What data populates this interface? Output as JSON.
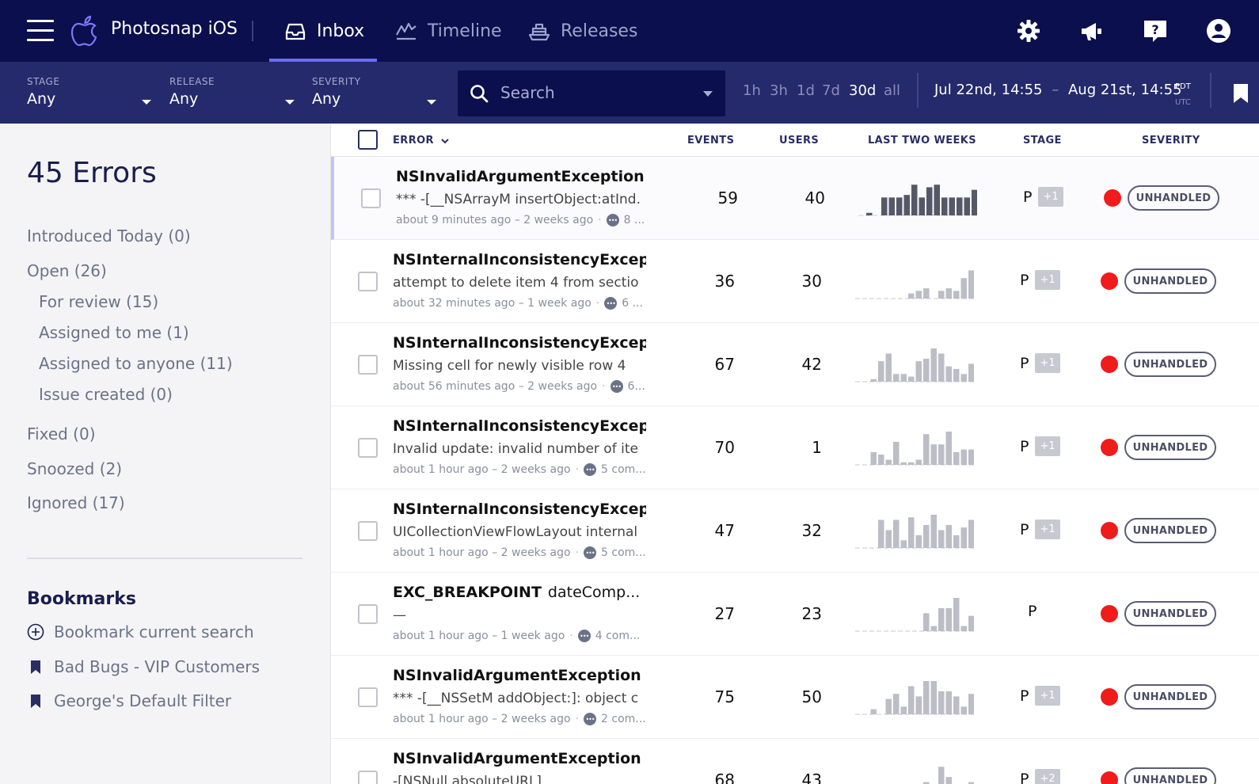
{
  "nav": {
    "app_name": "Photosnap iOS",
    "tabs": [
      {
        "label": "Inbox",
        "icon": "inbox-icon",
        "active": true
      },
      {
        "label": "Timeline",
        "icon": "timeline-icon",
        "active": false
      },
      {
        "label": "Releases",
        "icon": "releases-icon",
        "active": false
      }
    ],
    "right_icons": [
      "settings-icon",
      "announcements-icon",
      "help-icon",
      "account-icon"
    ]
  },
  "filters": {
    "stage": {
      "label": "STAGE",
      "value": "Any"
    },
    "release": {
      "label": "RELEASE",
      "value": "Any"
    },
    "severity": {
      "label": "SEVERITY",
      "value": "Any"
    },
    "search_placeholder": "Search",
    "ranges": [
      "1h",
      "3h",
      "1d",
      "7d",
      "30d",
      "all"
    ],
    "active_range": "30d",
    "date_from": "Jul 22nd, 14:55",
    "date_sep": "–",
    "date_to": "Aug 21st, 14:55",
    "tz_primary": "PDT",
    "tz_secondary": "UTC"
  },
  "sidebar": {
    "count_title": "45 Errors",
    "items": [
      "Introduced Today (0)",
      "Open (26)",
      "For review (15)",
      "Assigned to me (1)",
      "Assigned to anyone (11)",
      "Issue created (0)",
      "Fixed (0)",
      "Snoozed (2)",
      "Ignored (17)"
    ],
    "bookmarks_title": "Bookmarks",
    "bookmarks": [
      {
        "label": "Bookmark current search",
        "icon": "add-circle-icon"
      },
      {
        "label": "Bad Bugs - VIP Customers",
        "icon": "bookmark-icon"
      },
      {
        "label": "George's Default Filter",
        "icon": "bookmark-icon"
      }
    ]
  },
  "table": {
    "headers": {
      "error": "ERROR",
      "events": "EVENTS",
      "users": "USERS",
      "trend": "LAST TWO WEEKS",
      "stage": "STAGE",
      "severity": "SEVERITY"
    },
    "rows": [
      {
        "title": "NSInvalidArgumentException",
        "ext": "...",
        "message": "*** -[__NSArrayM insertObject:atInd...",
        "meta": "about 9 minutes ago – 2 weeks ago",
        "comments": "8 ...",
        "events": "59",
        "users": "40",
        "stage": "P",
        "stage_extra": "+1",
        "severity": "UNHANDLED",
        "spark": [
          1,
          0,
          7,
          7,
          7,
          8,
          12,
          7,
          11,
          12,
          7,
          7,
          7,
          7,
          10
        ],
        "spark_dark": true
      },
      {
        "title": "NSInternalInconsistencyExcept...",
        "ext": "",
        "message": "attempt to delete item 4 from sectio...",
        "meta": "about 32 minutes ago – 1 week ago",
        "comments": "6 ...",
        "events": "36",
        "users": "30",
        "stage": "P",
        "stage_extra": "+1",
        "severity": "UNHANDLED",
        "spark": [
          0,
          0,
          0,
          0,
          0,
          0,
          2,
          3,
          4,
          0,
          3,
          4,
          3,
          8,
          11
        ],
        "spark_dark": false
      },
      {
        "title": "NSInternalInconsistencyExcept...",
        "ext": "",
        "message": "Missing cell for newly visible row 4",
        "meta": "about 56 minutes ago – 2 weeks ago",
        "comments": "6...",
        "events": "67",
        "users": "42",
        "stage": "P",
        "stage_extra": "+1",
        "severity": "UNHANDLED",
        "spark": [
          0,
          1,
          8,
          11,
          3,
          3,
          2,
          8,
          9,
          13,
          11,
          6,
          5,
          3,
          7
        ],
        "spark_dark": false
      },
      {
        "title": "NSInternalInconsistencyExcept...",
        "ext": "",
        "message": "Invalid update: invalid number of ite...",
        "meta": "about 1 hour ago – 2 weeks ago",
        "comments": "5 com...",
        "events": "70",
        "users": "1",
        "stage": "P",
        "stage_extra": "+1",
        "severity": "UNHANDLED",
        "spark": [
          0,
          5,
          4,
          2,
          9,
          1,
          1,
          2,
          12,
          8,
          8,
          13,
          5,
          6,
          6
        ],
        "spark_dark": false
      },
      {
        "title": "NSInternalInconsistencyExcept...",
        "ext": "",
        "message": "UICollectionViewFlowLayout internal...",
        "meta": "about 1 hour ago – 2 weeks ago",
        "comments": "5 com...",
        "events": "47",
        "users": "32",
        "stage": "P",
        "stage_extra": "+1",
        "severity": "UNHANDLED",
        "spark": [
          0,
          0,
          11,
          7,
          11,
          3,
          12,
          5,
          9,
          13,
          7,
          9,
          5,
          8,
          11
        ],
        "spark_dark": false
      },
      {
        "title": "EXC_BREAKPOINT",
        "ext": "dateComp...",
        "message": "—",
        "meta": "about 1 hour ago – 1 week ago",
        "comments": "4 com...",
        "events": "27",
        "users": "23",
        "stage": "P",
        "stage_extra": "",
        "severity": "UNHANDLED",
        "spark": [
          0,
          0,
          0,
          0,
          0,
          0,
          0,
          0,
          7,
          2,
          9,
          9,
          13,
          2,
          6
        ],
        "spark_dark": false
      },
      {
        "title": "NSInvalidArgumentException",
        "ext": "...",
        "message": "*** -[__NSSetM addObject:]: object c...",
        "meta": "about 1 hour ago – 2 weeks ago",
        "comments": "2 com...",
        "events": "75",
        "users": "50",
        "stage": "P",
        "stage_extra": "+1",
        "severity": "UNHANDLED",
        "spark": [
          0,
          2,
          0,
          6,
          8,
          3,
          11,
          7,
          13,
          13,
          9,
          9,
          7,
          3,
          8
        ],
        "spark_dark": false
      },
      {
        "title": "NSInvalidArgumentException",
        "ext": "...",
        "message": "-[NSNull absoluteURL]",
        "meta": "about 1 hour ago – 2 weeks ago",
        "comments": "2 com...",
        "events": "68",
        "users": "43",
        "stage": "P",
        "stage_extra": "+2",
        "severity": "UNHANDLED",
        "spark": [
          0,
          0,
          0,
          0,
          0,
          0,
          0,
          0,
          6,
          0,
          12,
          8,
          4,
          0,
          6
        ],
        "spark_dark": false
      }
    ]
  },
  "colors": {
    "nav_bg": "#0b0f4d",
    "filter_bg": "#242a6b",
    "accent": "#6e6cf0",
    "severity_dot": "#f01b1b"
  }
}
